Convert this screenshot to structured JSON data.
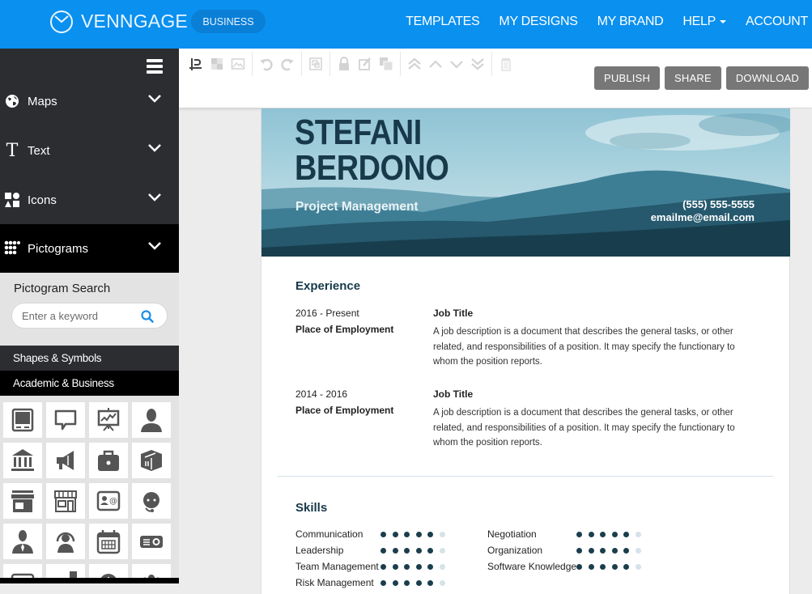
{
  "topbar": {
    "logo_icon": "venngage-clock-logo-icon",
    "brand": "VENNGAGE",
    "plan_badge": "BUSINESS",
    "nav": [
      {
        "label": "TEMPLATES",
        "dropdown": false
      },
      {
        "label": "MY DESIGNS",
        "dropdown": false
      },
      {
        "label": "MY BRAND",
        "dropdown": false
      },
      {
        "label": "HELP",
        "dropdown": true
      },
      {
        "label": "ACCOUNT",
        "dropdown": true
      }
    ]
  },
  "sidebar": {
    "menu_icon": "hamburger-icon",
    "items": [
      {
        "label": "Maps",
        "icon": "globe-icon",
        "active": false
      },
      {
        "label": "Text",
        "icon": "text-t-icon",
        "active": false
      },
      {
        "label": "Icons",
        "icon": "shapes-icon",
        "active": false
      },
      {
        "label": "Pictograms",
        "icon": "dot-grid-icon",
        "active": true
      }
    ],
    "pictogram_search": {
      "title": "Pictogram Search",
      "placeholder": "Enter a keyword",
      "value": ""
    },
    "categories": [
      {
        "label": "Shapes & Symbols"
      },
      {
        "label": "Academic & Business"
      }
    ],
    "pictograms": [
      "monitor-icon",
      "speech-bubble-icon",
      "presentation-chart-icon",
      "businessman-icon",
      "bank-building-icon",
      "megaphone-icon",
      "briefcase-icon",
      "shipping-box-icon",
      "storefront-icon",
      "shop-outline-icon",
      "contact-card-icon",
      "support-agent-icon",
      "manager-icon",
      "user-circle-icon",
      "calendar-icon",
      "projector-icon",
      "keyboard-icon",
      "arrow-chart-icon",
      "clock-icon",
      "team-icon"
    ]
  },
  "toolbar": {
    "tools": [
      {
        "name": "text-format-icon",
        "group": 1
      },
      {
        "name": "transparency-icon",
        "group": 1
      },
      {
        "name": "image-icon",
        "group": 1
      },
      {
        "name": "undo-icon",
        "group": 2
      },
      {
        "name": "redo-icon",
        "group": 2
      },
      {
        "name": "group-icon",
        "group": 3
      },
      {
        "name": "lock-icon",
        "group": 4
      },
      {
        "name": "edit-icon",
        "group": 4
      },
      {
        "name": "duplicate-icon",
        "group": 4
      },
      {
        "name": "bring-to-front-icon",
        "group": 5
      },
      {
        "name": "bring-forward-icon",
        "group": 5
      },
      {
        "name": "send-backward-icon",
        "group": 5
      },
      {
        "name": "send-to-back-icon",
        "group": 5
      },
      {
        "name": "trash-icon",
        "group": 6
      }
    ],
    "publish_label": "PUBLISH",
    "share_label": "SHARE",
    "download_label": "DOWNLOAD"
  },
  "resume": {
    "first_name": "STEFANI",
    "last_name": "BERDONO",
    "role": "Project Management",
    "phone": "(555) 555-5555",
    "email": "emailme@email.com",
    "experience_title": "Experience",
    "experience": [
      {
        "when": "2016 - Present",
        "where": "Place of Employment",
        "title": "Job Title",
        "description": "A job description is a document that describes the general tasks, or other related, and responsibilities of a position. It may specify the functionary to whom the position reports."
      },
      {
        "when": "2014 - 2016",
        "where": "Place of Employment",
        "title": "Job Title",
        "description": "A job description is a document that describes the general tasks, or other related, and responsibilities of a position. It may specify the functionary to whom the position reports."
      }
    ],
    "skills_title": "Skills",
    "skills": [
      {
        "label": "Communication",
        "rating": 5,
        "max": 6
      },
      {
        "label": "Leadership",
        "rating": 5,
        "max": 6
      },
      {
        "label": "Team Management",
        "rating": 5,
        "max": 6
      },
      {
        "label": "Risk Management",
        "rating": 5,
        "max": 6
      },
      {
        "label": "Negotiation",
        "rating": 5,
        "max": 6
      },
      {
        "label": "Organization",
        "rating": 5,
        "max": 6
      },
      {
        "label": "Software Knowledge",
        "rating": 5,
        "max": 6
      }
    ]
  },
  "colors": {
    "topbar": "#0a90ef",
    "sidebar": "#2b2d31",
    "sidebar_active": "#000000",
    "action_button": "#777777",
    "resume_dark": "#17394a",
    "skill_dot_on": "#1b3e4c",
    "skill_dot_off": "#d6e2ea"
  }
}
